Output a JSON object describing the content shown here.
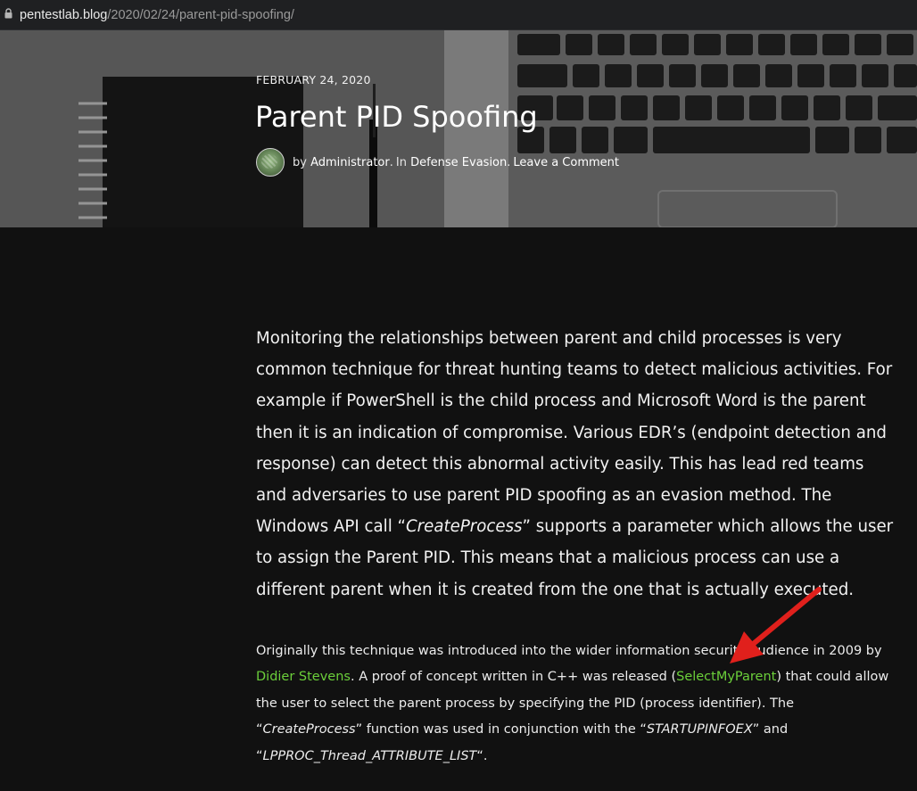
{
  "address_bar": {
    "host": "pentestlab.blog",
    "path": "/2020/02/24/parent-pid-spoofing/"
  },
  "post": {
    "date": "FEBRUARY 24, 2020",
    "title": "Parent PID Spoofing",
    "meta": {
      "by": "by",
      "author": "Administrator",
      "in": "In",
      "category": "Defense Evasion",
      "comment_link": "Leave a Comment"
    }
  },
  "body": {
    "lead": {
      "part1": "Monitoring the relationships between parent and child processes is very common technique for threat hunting teams to detect malicious activities. For example if PowerShell is the child process and Microsoft Word is the parent then it is an indication of compromise. Various EDR’s (endpoint detection and response) can detect this abnormal activity easily. This has lead red teams and adversaries to use parent PID spoofing as an evasion method. The Windows API call “",
      "em": "CreateProcess",
      "part2": "” supports a parameter which allows the user to assign the Parent PID. This means that a malicious process can use a different parent when it is created from the one that is actually executed."
    },
    "para2": {
      "t1": "Originally this technique was introduced into the wider information security audience in 2009 by ",
      "link1": "Didier Stevens",
      "t2": ". A proof of concept written in C++ was released (",
      "link2": "SelectMyParent",
      "t3": ") that could allow the user to select the parent process by specifying the PID (process identifier). The “",
      "em1": "CreateProcess",
      "t4": "” function was used in conjunction with the “",
      "em2": "STARTUPINFOEX",
      "t5": "” and “",
      "em3": "LPPROC_Thread_ATTRIBUTE_LIST",
      "t6": "“."
    }
  },
  "colors": {
    "page_bg": "#111111",
    "link_green": "#6bcf3a",
    "annotation_arrow": "#e0201c"
  }
}
